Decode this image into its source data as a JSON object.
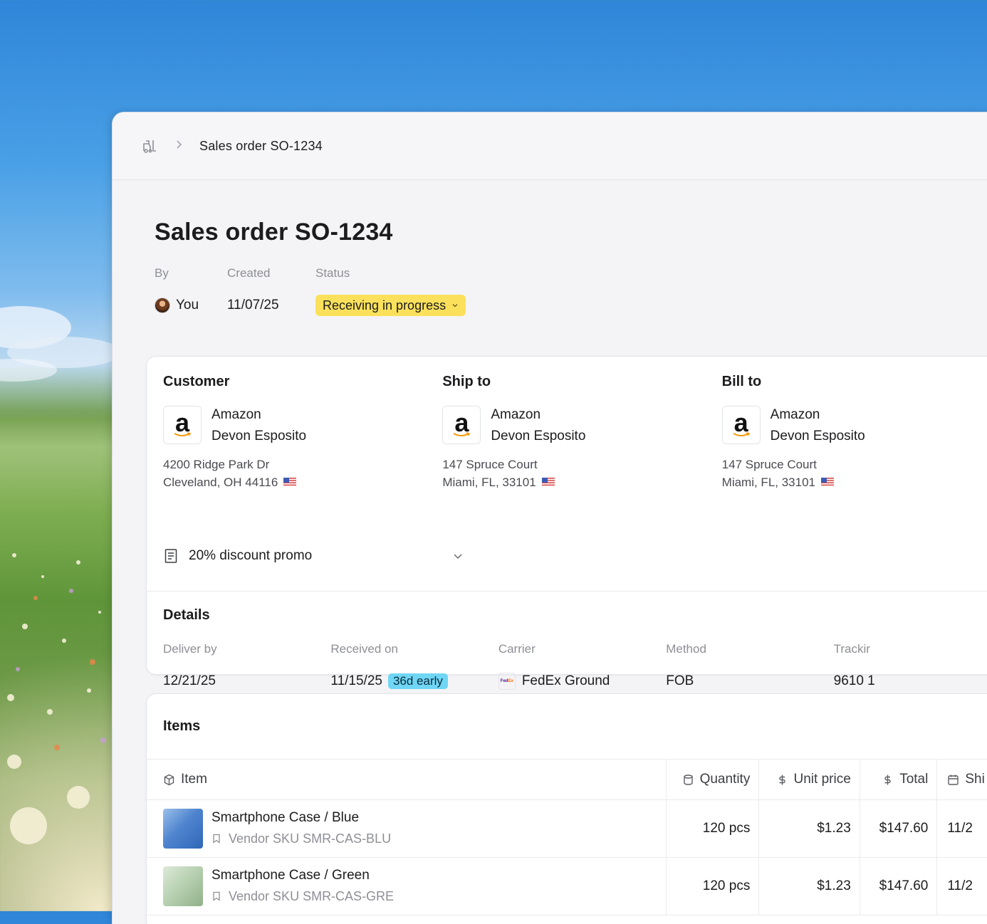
{
  "breadcrumb": {
    "current": "Sales order SO-1234"
  },
  "page": {
    "title": "Sales order SO-1234"
  },
  "meta": {
    "by_label": "By",
    "by_value": "You",
    "created_label": "Created",
    "created_value": "11/07/25",
    "status_label": "Status",
    "status_value": "Receiving in progress"
  },
  "customer": {
    "title": "Customer",
    "company": "Amazon",
    "contact": "Devon Esposito",
    "address_line1": "4200 Ridge Park Dr",
    "address_line2": "Cleveland, OH 44116"
  },
  "ship_to": {
    "title": "Ship to",
    "company": "Amazon",
    "contact": "Devon Esposito",
    "address_line1": "147 Spruce Court",
    "address_line2": "Miami, FL, 33101"
  },
  "bill_to": {
    "title": "Bill to",
    "company": "Amazon",
    "contact": "Devon Esposito",
    "address_line1": "147 Spruce Court",
    "address_line2": "Miami, FL, 33101"
  },
  "promo": {
    "label": "20% discount promo"
  },
  "details": {
    "title": "Details",
    "deliver_by_label": "Deliver by",
    "deliver_by_value": "12/21/25",
    "received_on_label": "Received on",
    "received_on_value": "11/15/25",
    "early_badge": "36d early",
    "carrier_label": "Carrier",
    "carrier_value": "FedEx Ground",
    "method_label": "Method",
    "method_value": "FOB",
    "tracking_label": "Trackir",
    "tracking_value": "9610 1"
  },
  "items": {
    "title": "Items",
    "columns": {
      "item": "Item",
      "quantity": "Quantity",
      "unit_price": "Unit price",
      "total": "Total",
      "ship": "Shi"
    },
    "rows": [
      {
        "name": "Smartphone Case / Blue",
        "sku": "Vendor SKU SMR-CAS-BLU",
        "quantity": "120 pcs",
        "unit_price": "$1.23",
        "total": "$147.60",
        "ship": "11/2"
      },
      {
        "name": "Smartphone Case / Green",
        "sku": "Vendor SKU SMR-CAS-GRE",
        "quantity": "120 pcs",
        "unit_price": "$1.23",
        "total": "$147.60",
        "ship": "11/2"
      }
    ]
  },
  "colors": {
    "status_pill": "#fbe15b",
    "early_badge": "#6fd6f5",
    "window_bg": "#f4f4f6"
  },
  "icons": [
    "forklift-icon",
    "chevron-right-icon",
    "chevron-down-icon",
    "amazon-logo",
    "us-flag-icon",
    "receipt-icon",
    "fedex-logo",
    "box-icon",
    "cylinder-icon",
    "dollar-icon",
    "calendar-icon",
    "bookmark-icon"
  ]
}
